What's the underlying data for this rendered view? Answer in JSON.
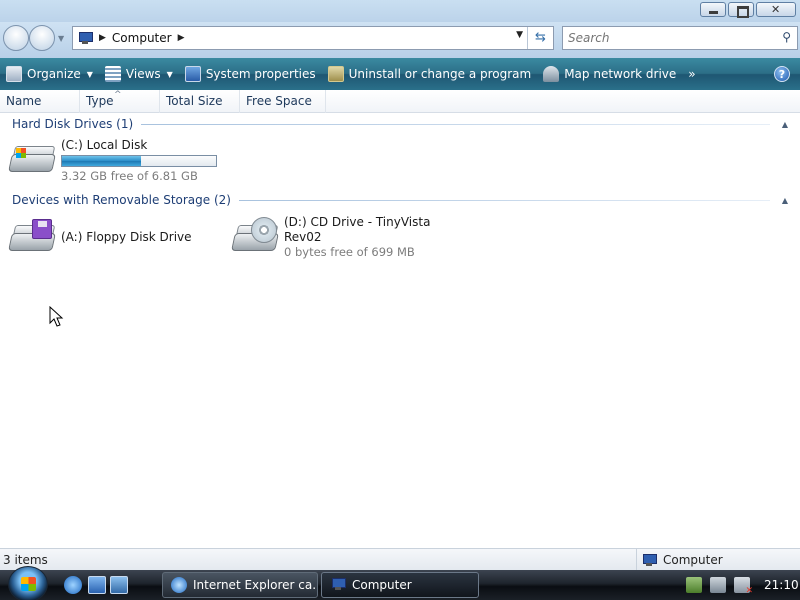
{
  "window": {
    "title": ""
  },
  "address_bar": {
    "crumb": "Computer",
    "search_placeholder": "Search"
  },
  "toolbar": {
    "organize": "Organize",
    "views": "Views",
    "system_properties": "System properties",
    "uninstall": "Uninstall or change a program",
    "map_drive": "Map network drive",
    "more": "»"
  },
  "columns": [
    "Name",
    "Type",
    "Total Size",
    "Free Space"
  ],
  "groups": {
    "hard_disks": {
      "title": "Hard Disk Drives (1)",
      "items": [
        {
          "name": "(C:) Local Disk",
          "detail": "3.32 GB free of 6.81 GB",
          "used_fraction": 0.51
        }
      ]
    },
    "removable": {
      "title": "Devices with Removable Storage (2)",
      "items": [
        {
          "name": "(A:) Floppy Disk Drive"
        },
        {
          "name_line1": "(D:) CD Drive - TinyVista",
          "name_line2": "Rev02",
          "detail": "0 bytes free of 699 MB"
        }
      ]
    }
  },
  "statusbar": {
    "items_count": "3 items",
    "location": "Computer"
  },
  "taskbar": {
    "tasks": [
      "Internet Explorer ca...",
      "Computer"
    ],
    "clock": "21:10"
  },
  "colors": {
    "toolbar": "#2c6e87",
    "group_title": "#1e3e75",
    "capacity_fill": "#2a8dc8"
  },
  "icons": {
    "organize": "organize-icon",
    "views": "views-icon",
    "system_properties": "system-properties-icon",
    "uninstall": "uninstall-icon",
    "map_drive": "map-drive-icon",
    "help": "help-icon",
    "search": "search-icon",
    "refresh": "refresh-icon"
  }
}
